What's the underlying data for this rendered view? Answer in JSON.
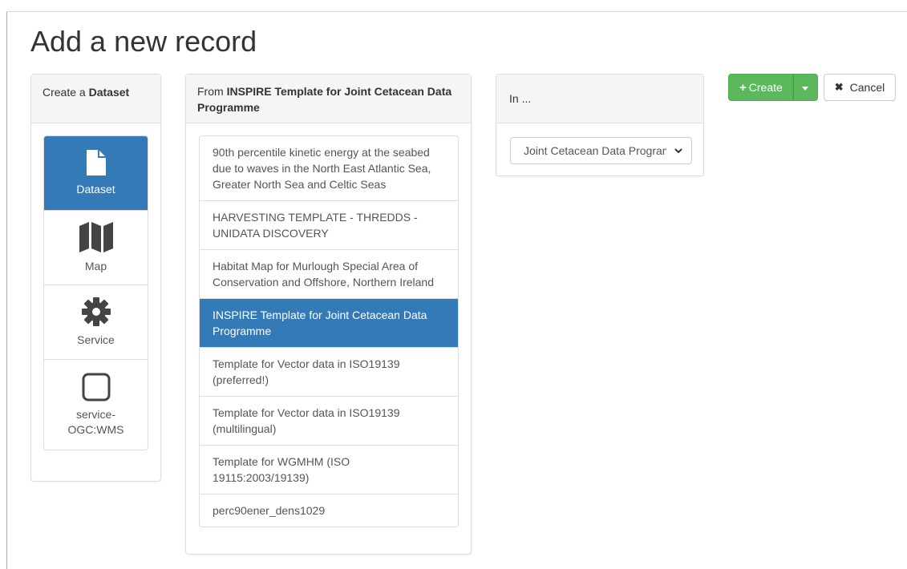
{
  "page": {
    "title": "Add a new record"
  },
  "type_panel": {
    "heading_prefix": "Create a ",
    "heading_bold": "Dataset",
    "items": [
      {
        "label": "Dataset",
        "icon": "file-icon",
        "active": true
      },
      {
        "label": "Map",
        "icon": "map-icon",
        "active": false
      },
      {
        "label": "Service",
        "icon": "gear-icon",
        "active": false
      },
      {
        "label": "service-\nOGC:WMS",
        "icon": "square-icon",
        "active": false
      }
    ]
  },
  "template_panel": {
    "heading_prefix": "From ",
    "heading_bold": "INSPIRE Template for Joint Cetacean Data Programme",
    "items": [
      {
        "label": "90th percentile kinetic energy at the seabed due to waves in the North East Atlantic Sea, Greater North Sea and Celtic Seas",
        "active": false
      },
      {
        "label": "HARVESTING TEMPLATE - THREDDS - UNIDATA DISCOVERY",
        "active": false
      },
      {
        "label": "Habitat Map for Murlough Special Area of Conservation and Offshore, Northern Ireland",
        "active": false
      },
      {
        "label": "INSPIRE Template for Joint Cetacean Data Programme",
        "active": true
      },
      {
        "label": "Template for Vector data in ISO19139 (preferred!)",
        "active": false
      },
      {
        "label": "Template for Vector data in ISO19139 (multilingual)",
        "active": false
      },
      {
        "label": "Template for WGMHM (ISO 19115:2003/19139)",
        "active": false
      },
      {
        "label": "perc90ener_dens1029",
        "active": false
      }
    ]
  },
  "group_panel": {
    "heading": "In ...",
    "selected": "Joint Cetacean Data Programme"
  },
  "actions": {
    "create_label": "Create",
    "cancel_label": "Cancel"
  },
  "colors": {
    "primary": "#337ab7",
    "success": "#5cb85c"
  }
}
